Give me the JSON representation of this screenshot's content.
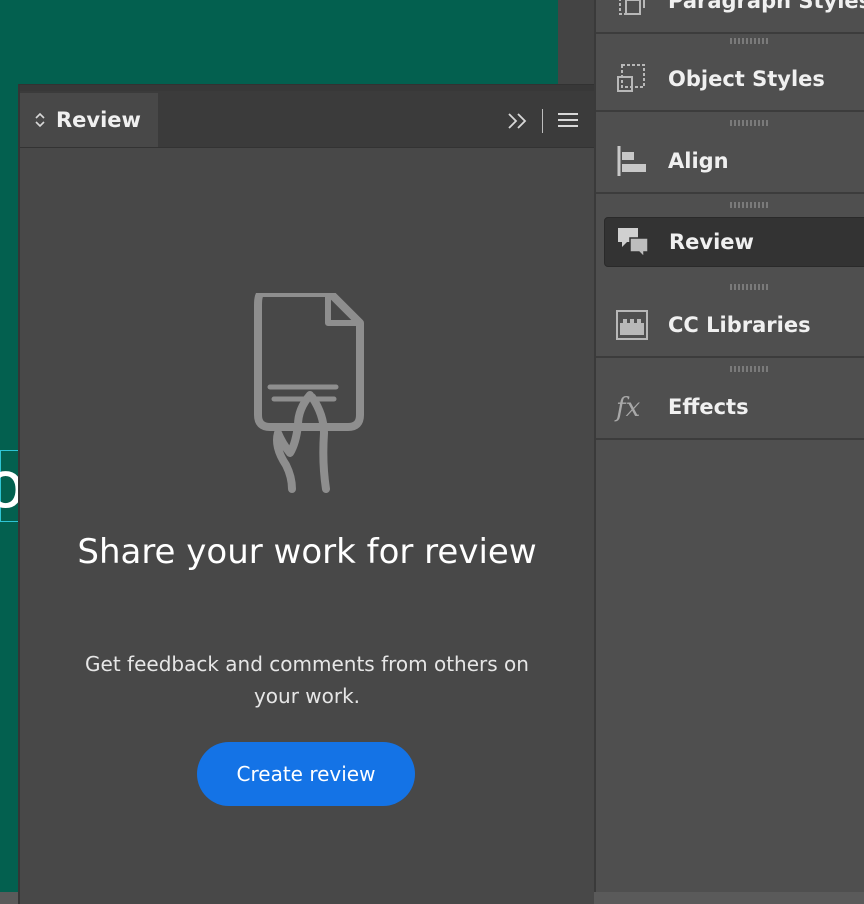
{
  "review_panel": {
    "tab_label": "Review",
    "headline": "Share your work for review",
    "description": "Get feedback and comments from others on your work.",
    "create_button_label": "Create review"
  },
  "dock": {
    "items": [
      {
        "label": "Paragraph Styles",
        "icon": "paragraph-styles-icon"
      },
      {
        "label": "Object Styles",
        "icon": "object-styles-icon"
      },
      {
        "label": "Align",
        "icon": "align-icon"
      },
      {
        "label": "Review",
        "icon": "review-icon",
        "active": true
      },
      {
        "label": "CC Libraries",
        "icon": "cc-libraries-icon"
      },
      {
        "label": "Effects",
        "icon": "fx-icon"
      }
    ]
  },
  "colors": {
    "accent": "#1473e6",
    "canvas": "#03604f",
    "panel": "#484848",
    "dock": "#4f4f4f"
  }
}
